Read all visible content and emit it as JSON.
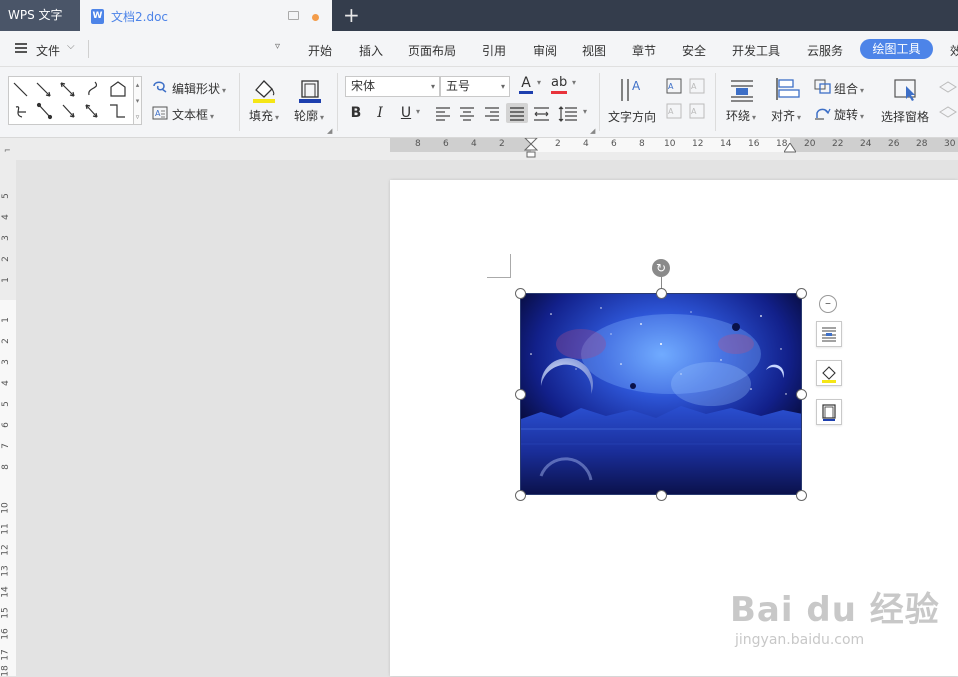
{
  "titlebar": {
    "app_tab": "WPS 文字",
    "doc_tab": "文档2.doc",
    "doc_icon_letter": "W",
    "new_tab": "+"
  },
  "menubar": {
    "file_label": "文件",
    "items": [
      "开始",
      "插入",
      "页面布局",
      "引用",
      "审阅",
      "视图",
      "章节",
      "安全",
      "开发工具",
      "云服务"
    ],
    "active_tab": "绘图工具",
    "overflow_item": "效"
  },
  "ribbon": {
    "edit_shape": "编辑形状",
    "text_box": "文本框",
    "fill": "填充",
    "outline": "轮廓",
    "font_name": "宋体",
    "font_size": "五号",
    "text_direction": "文字方向",
    "wrap": "环绕",
    "align": "对齐",
    "group": "组合",
    "rotate": "旋转",
    "selection_pane": "选择窗格",
    "bold": "B",
    "italic": "I",
    "underline": "U",
    "font_color_letter": "A",
    "highlight_letter": "ab"
  },
  "ruler": {
    "horizontal_numbers": [
      "8",
      "6",
      "4",
      "2",
      "2",
      "4",
      "6",
      "8",
      "10",
      "12",
      "14",
      "16",
      "18",
      "20",
      "22",
      "24",
      "26",
      "28",
      "30"
    ],
    "vertical_numbers": [
      "5",
      "4",
      "3",
      "2",
      "1",
      "1",
      "2",
      "3",
      "4",
      "5",
      "6",
      "7",
      "8",
      "10",
      "11",
      "12",
      "13",
      "14",
      "15",
      "16",
      "17",
      "18"
    ]
  },
  "watermark": {
    "brand": "Bai du 经验",
    "url": "jingyan.baidu.com"
  },
  "colors": {
    "accent": "#4d84e8",
    "titlebar": "#343d4c",
    "fill_yellow": "#f5e616",
    "outline_blue": "#1d3fae",
    "font_color_blue": "#1d3fae",
    "highlight_red": "#e8333b",
    "tab_dot": "#f39c4a"
  }
}
